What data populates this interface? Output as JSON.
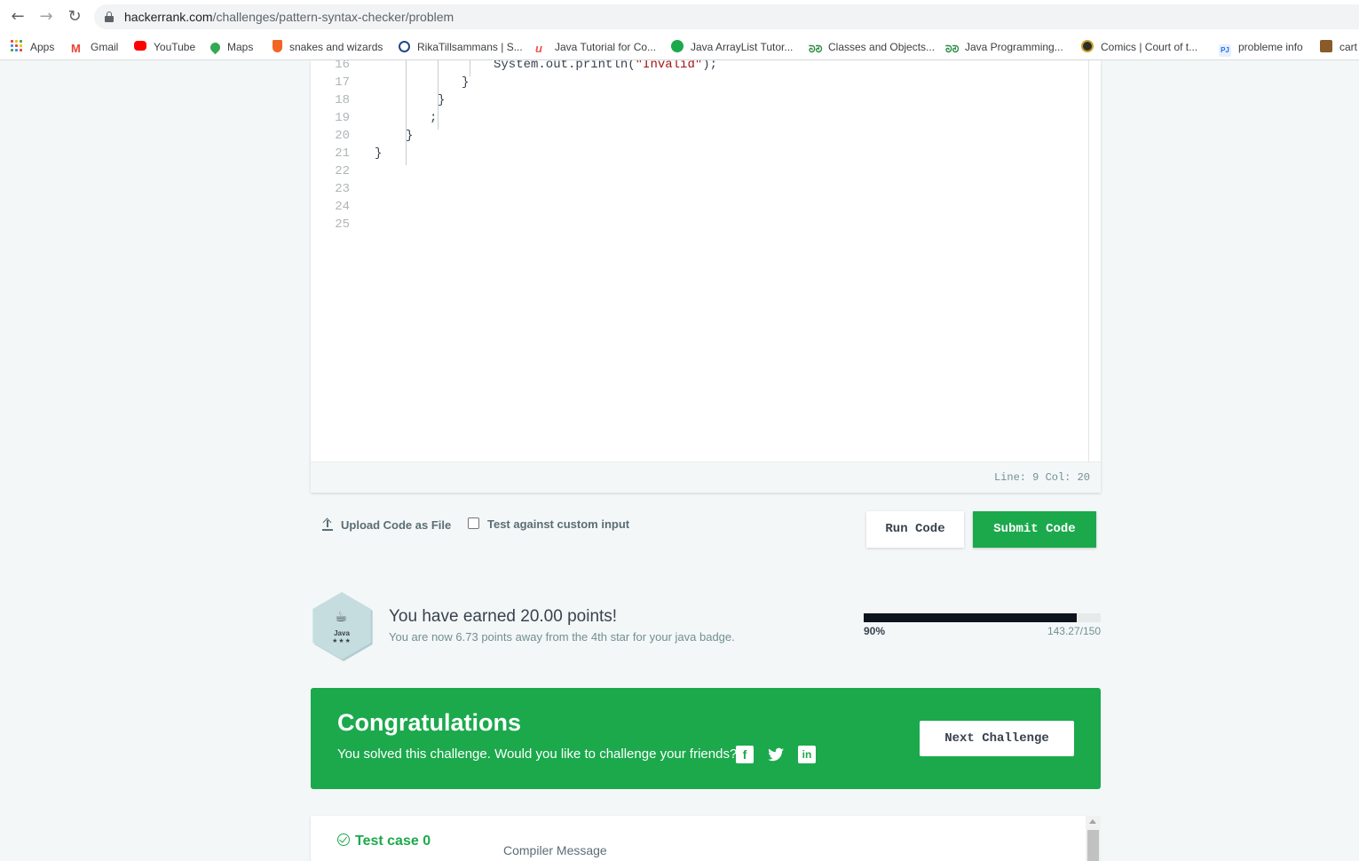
{
  "browser": {
    "url_host": "hackerrank.com",
    "url_path": "/challenges/pattern-syntax-checker/problem",
    "nav": {
      "back_icon": "arrow-left-icon",
      "forward_icon": "arrow-right-icon",
      "reload_icon": "reload-icon"
    },
    "bookmarks": [
      {
        "label": "Apps",
        "icon": "apps-grid-icon"
      },
      {
        "label": "Gmail",
        "icon": "gmail-icon"
      },
      {
        "label": "YouTube",
        "icon": "youtube-icon"
      },
      {
        "label": "Maps",
        "icon": "maps-pin-icon"
      },
      {
        "label": "snakes and wizards",
        "icon": "shield-icon"
      },
      {
        "label": "RikaTillsammans | S...",
        "icon": "loop-icon"
      },
      {
        "label": "Java Tutorial for Co...",
        "icon": "udemy-icon"
      },
      {
        "label": "Java ArrayList Tutor...",
        "icon": "circle-c-icon"
      },
      {
        "label": "Classes and Objects...",
        "icon": "gfg-icon"
      },
      {
        "label": "Java Programming...",
        "icon": "gfg-icon"
      },
      {
        "label": "Comics | Court of t...",
        "icon": "comic-icon"
      },
      {
        "label": "probleme info",
        "icon": "pj-icon"
      },
      {
        "label": "cart",
        "icon": "cart-image-icon"
      }
    ]
  },
  "editor": {
    "lines": [
      {
        "num": "16",
        "code": "System.out.println(",
        "str": "\"Invalid\"",
        "after": ");"
      },
      {
        "num": "17",
        "code": "}",
        "str": "",
        "after": ""
      },
      {
        "num": "18",
        "code": "}",
        "str": "",
        "after": ""
      },
      {
        "num": "19",
        "code": ";",
        "str": "",
        "after": ""
      },
      {
        "num": "20",
        "code": "}",
        "str": "",
        "after": ""
      },
      {
        "num": "21",
        "code": "}",
        "str": "",
        "after": ""
      },
      {
        "num": "22",
        "code": "",
        "str": "",
        "after": ""
      },
      {
        "num": "23",
        "code": "",
        "str": "",
        "after": ""
      },
      {
        "num": "24",
        "code": "",
        "str": "",
        "after": ""
      },
      {
        "num": "25",
        "code": "",
        "str": "",
        "after": ""
      }
    ],
    "status": "Line: 9 Col: 20"
  },
  "actions": {
    "upload_label": "Upload Code as File",
    "custom_input_label": "Test against custom input",
    "custom_input_checked": false,
    "run_label": "Run Code",
    "submit_label": "Submit Code"
  },
  "badge": {
    "name": "Java",
    "stars": "★★★",
    "earned_text": "You have earned 20.00 points!",
    "away_text": "You are now 6.73 points away from the 4th star for your java badge.",
    "progress_percent_label": "90%",
    "progress_value_label": "143.27/150",
    "progress_fraction": 0.9
  },
  "congrats": {
    "title": "Congratulations",
    "subtitle": "You solved this challenge. Would you like to challenge your friends?",
    "share_icons": [
      "facebook-icon",
      "twitter-icon",
      "linkedin-icon"
    ],
    "next_label": "Next Challenge"
  },
  "testcase": {
    "label": "Test case 0",
    "compiler_message": "Compiler Message"
  },
  "colors": {
    "accent_green": "#1ba94c",
    "text_dark": "#39424e",
    "progress_fill": "#0e141e"
  }
}
